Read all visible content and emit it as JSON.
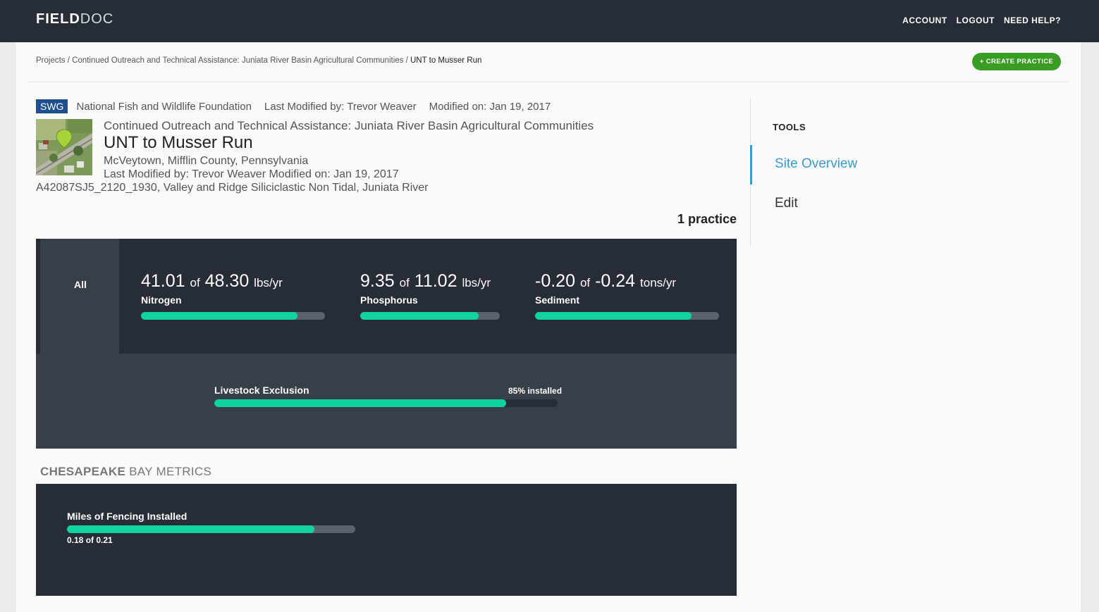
{
  "header": {
    "logo_bold": "FIELD",
    "logo_light": "DOC",
    "nav": [
      "ACCOUNT",
      "LOGOUT",
      "NEED HELP?"
    ]
  },
  "breadcrumb": {
    "items": [
      "Projects",
      "Continued Outreach and Technical Assistance: Juniata River Basin Agricultural Communities"
    ],
    "separator": " / ",
    "current": "UNT to Musser Run"
  },
  "create_button": "+ CREATE PRACTICE",
  "site": {
    "badge": "SWG",
    "organization": "National Fish and Wildlife Foundation",
    "last_modified_by": "Last Modified by: Trevor Weaver",
    "modified_on": "Modified on: Jan 19, 2017",
    "project_name": "Continued Outreach and Technical Assistance: Juniata River Basin Agricultural Communities",
    "title": "UNT to Musser Run",
    "location": "McVeytown, Mifflin County, Pennsylvania",
    "last_modified_line": "Last Modified by: Trevor Weaver Modified on: Jan 19, 2017",
    "segment": "A42087SJ5_2120_1930, Valley and Ridge Siliciclastic Non Tidal, Juniata River"
  },
  "practice_count": "1 practice",
  "summary": {
    "tab_label": "All",
    "metrics": [
      {
        "current": "41.01",
        "of": "of",
        "total": "48.30",
        "unit": "lbs/yr",
        "label": "Nitrogen",
        "progress": 0.849
      },
      {
        "current": "9.35",
        "of": "of",
        "total": "11.02",
        "unit": "lbs/yr",
        "label": "Phosphorus",
        "progress": 0.848
      },
      {
        "current": "-0.20",
        "of": "of",
        "total": "-0.24",
        "unit": "tons/yr",
        "label": "Sediment",
        "progress": 0.85
      }
    ],
    "practice": {
      "label": "Livestock Exclusion",
      "status": "85% installed",
      "progress": 0.85
    }
  },
  "cbm": {
    "title_bold": "CHESAPEAKE",
    "title_rest": " BAY METRICS",
    "metric_label": "Miles of Fencing Installed",
    "metric_value": "0.18 of 0.21",
    "progress": 0.857
  },
  "tools": {
    "title": "TOOLS",
    "items": [
      "Site Overview",
      "Edit"
    ]
  },
  "colors": {
    "header_bg": "#262d36",
    "accent_green": "#3a9d23",
    "progress_fill": "#10d3a2",
    "link_blue": "#3a9bd1",
    "badge_blue": "#1f4f8f"
  }
}
